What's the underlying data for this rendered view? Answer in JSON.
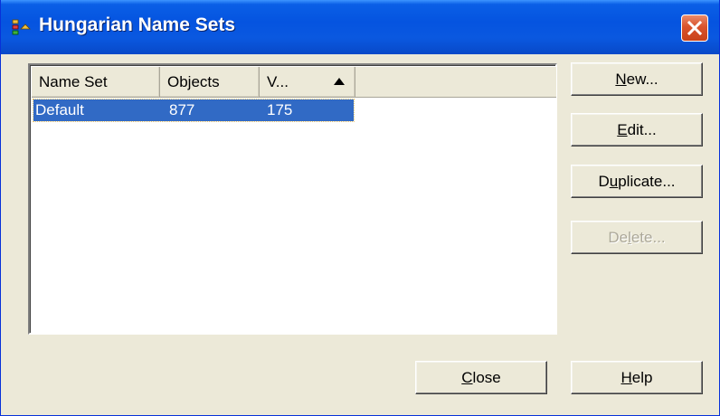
{
  "window": {
    "title": "Hungarian Name Sets",
    "icon": "name-sets-icon"
  },
  "list": {
    "columns": [
      {
        "label": "Name Set"
      },
      {
        "label": "Objects"
      },
      {
        "label": "V...",
        "sort": "ascending"
      }
    ],
    "rows": [
      {
        "name": "Default",
        "objects": "877",
        "v": "175",
        "selected": true
      }
    ]
  },
  "buttons": {
    "new": {
      "pre": "",
      "key": "N",
      "post": "ew..."
    },
    "edit": {
      "pre": "",
      "key": "E",
      "post": "dit..."
    },
    "duplicate": {
      "pre": "D",
      "key": "u",
      "post": "plicate..."
    },
    "delete": {
      "pre": "De",
      "key": "l",
      "post": "ete...",
      "enabled": false
    },
    "close": {
      "pre": "",
      "key": "C",
      "post": "lose"
    },
    "help": {
      "pre": "",
      "key": "H",
      "post": "elp"
    }
  },
  "colors": {
    "titlebar": "#0554e0",
    "selection": "#316ac5",
    "dialog_bg": "#ece9d8"
  }
}
